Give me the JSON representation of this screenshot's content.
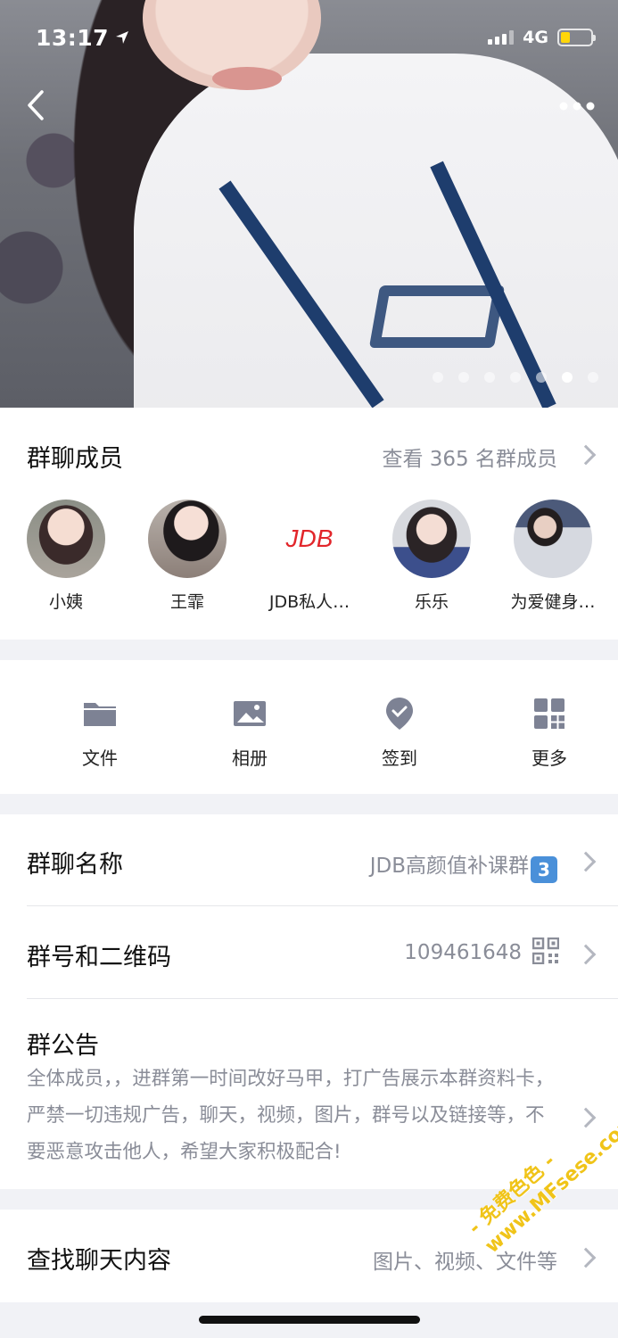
{
  "status_bar": {
    "time": "13:17",
    "network": "4G",
    "battery_level": 0.3
  },
  "gallery": {
    "page_count": 7,
    "current_index": 5
  },
  "members": {
    "title": "群聊成员",
    "view_all": "查看 365 名群成员",
    "list": [
      {
        "name": "小姨"
      },
      {
        "name": "王霏"
      },
      {
        "name": "JDB私人…",
        "logo": "JDB"
      },
      {
        "name": "乐乐"
      },
      {
        "name": "为爱健身…"
      }
    ]
  },
  "tools": [
    {
      "label": "文件",
      "icon": "folder-icon"
    },
    {
      "label": "相册",
      "icon": "image-icon"
    },
    {
      "label": "签到",
      "icon": "checkin-pin-icon"
    },
    {
      "label": "更多",
      "icon": "grid-icon"
    }
  ],
  "group_info": {
    "name_label": "群聊名称",
    "name_value": "JDB高颜值补课群",
    "name_badge": "3",
    "number_label": "群号和二维码",
    "number_value": "109461648",
    "notice_label": "群公告",
    "notice_text": "全体成员，，进群第一时间改好马甲，打广告展示本群资料卡，严禁一切违规广告，聊天，视频，图片，群号以及链接等，不要恶意攻击他人，希望大家积极配合!"
  },
  "search_chat": {
    "label": "查找聊天内容",
    "value": "图片、视频、文件等"
  },
  "watermark": {
    "line1": "- 免费色色 -",
    "line2": "www.MFsese.com"
  },
  "colors": {
    "accent_gray": "#8a8d98",
    "icon_gray": "#7d8294",
    "jdb_red": "#e2262b",
    "battery_yellow": "#ffd60a"
  }
}
